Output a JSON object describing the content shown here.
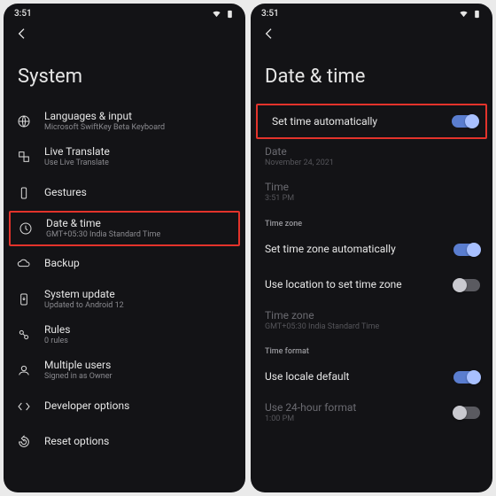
{
  "status": {
    "time": "3:51"
  },
  "left": {
    "title": "System",
    "items": [
      {
        "name": "languages",
        "label": "Languages & input",
        "sub": "Microsoft SwiftKey Beta Keyboard"
      },
      {
        "name": "livetranslate",
        "label": "Live Translate",
        "sub": "Use Live Translate"
      },
      {
        "name": "gestures",
        "label": "Gestures",
        "sub": ""
      },
      {
        "name": "datetime",
        "label": "Date & time",
        "sub": "GMT+05:30 India Standard Time"
      },
      {
        "name": "backup",
        "label": "Backup",
        "sub": ""
      },
      {
        "name": "sysupdate",
        "label": "System update",
        "sub": "Updated to Android 12"
      },
      {
        "name": "rules",
        "label": "Rules",
        "sub": "0 rules"
      },
      {
        "name": "multiusers",
        "label": "Multiple users",
        "sub": "Signed in as Owner"
      },
      {
        "name": "devopts",
        "label": "Developer options",
        "sub": ""
      },
      {
        "name": "reset",
        "label": "Reset options",
        "sub": ""
      }
    ]
  },
  "right": {
    "title": "Date & time",
    "set_time_auto": {
      "label": "Set time automatically",
      "on": true
    },
    "date": {
      "label": "Date",
      "value": "November 24, 2021"
    },
    "time": {
      "label": "Time",
      "value": "3:51 PM"
    },
    "sections": {
      "timezone": "Time zone",
      "timeformat": "Time format"
    },
    "set_tz_auto": {
      "label": "Set time zone automatically",
      "on": true
    },
    "use_location_tz": {
      "label": "Use location to set time zone",
      "on": false
    },
    "timezone": {
      "label": "Time zone",
      "value": "GMT+05:30 India Standard Time"
    },
    "use_locale": {
      "label": "Use locale default",
      "on": true
    },
    "use_24h": {
      "label": "Use 24-hour format",
      "value": "1:00 PM",
      "on": false
    }
  }
}
